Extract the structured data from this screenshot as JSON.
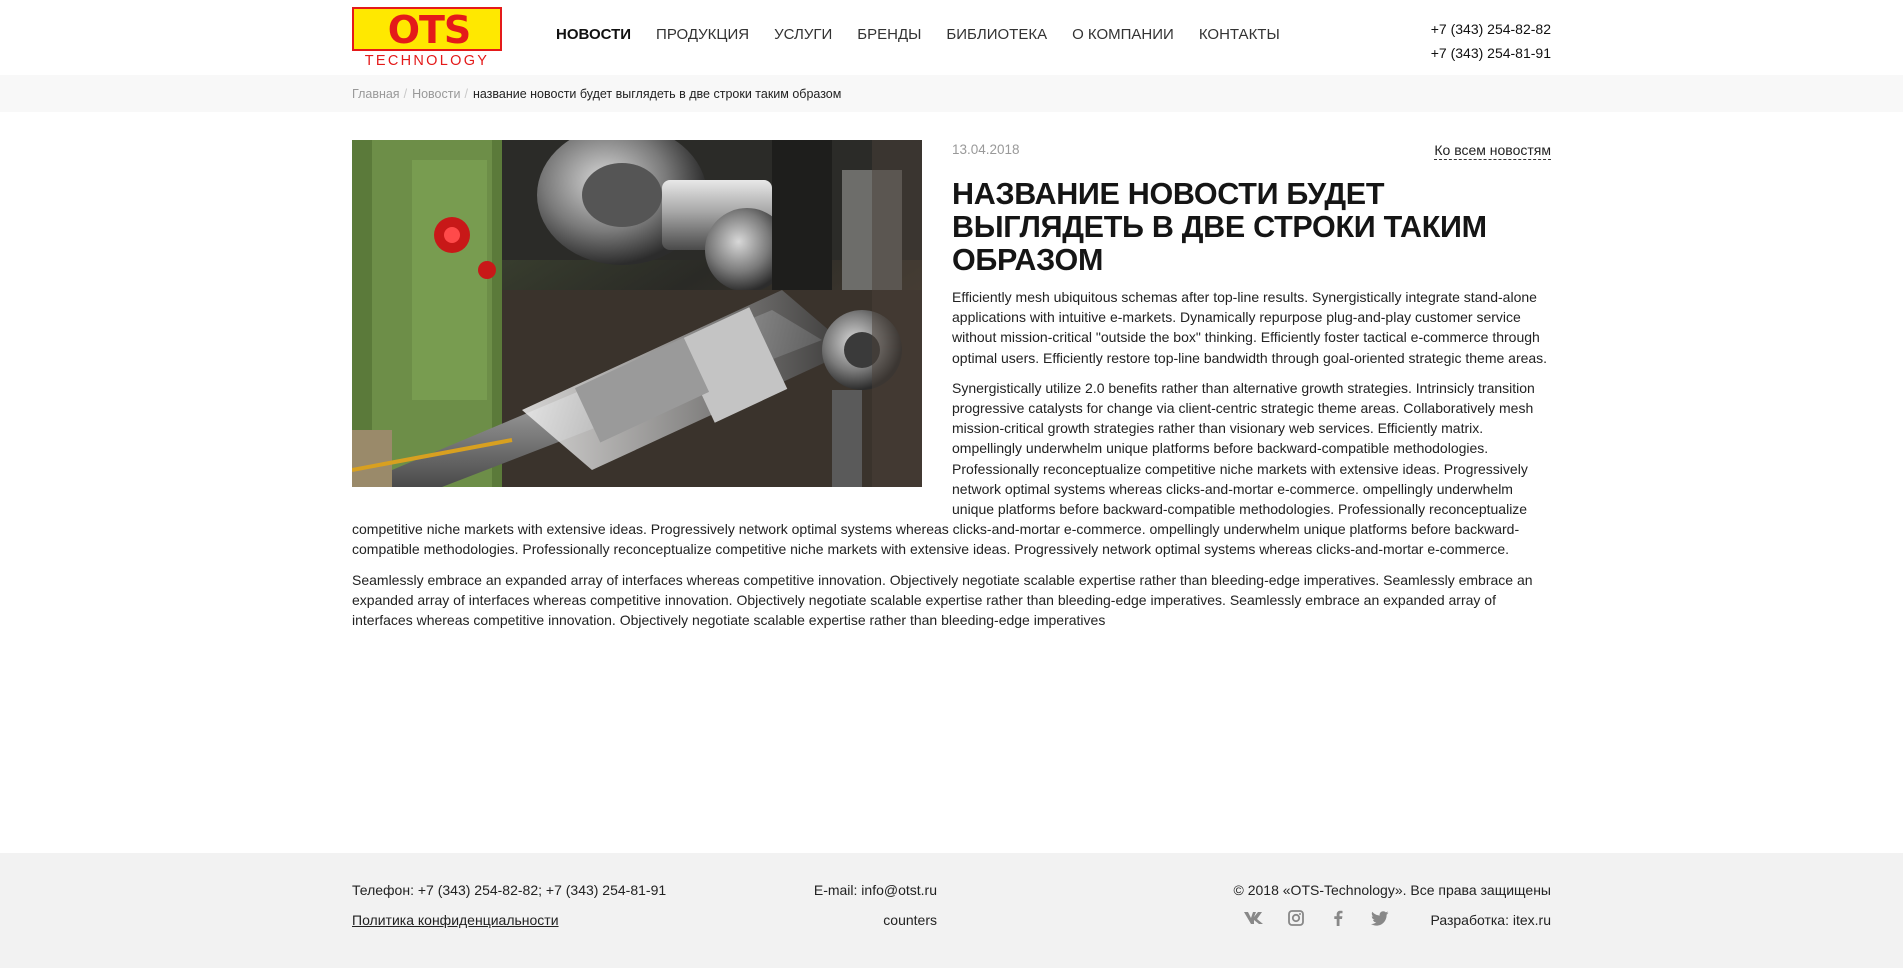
{
  "logo": {
    "letters": "OTS",
    "subtitle": "TECHNOLOGY"
  },
  "nav": {
    "items": [
      {
        "label": "Новости",
        "active": true
      },
      {
        "label": "Продукция"
      },
      {
        "label": "Услуги"
      },
      {
        "label": "Бренды"
      },
      {
        "label": "Библиотека"
      },
      {
        "label": "О компании"
      },
      {
        "label": "Контакты"
      }
    ]
  },
  "header": {
    "phones": [
      "+7 (343) 254-82-82",
      "+7 (343) 254-81-91"
    ]
  },
  "breadcrumb": {
    "home": "Главная",
    "section": "Новости",
    "current": "название новости будет выглядеть в две строки таким образом",
    "separator": "/"
  },
  "article": {
    "date": "13.04.2018",
    "all_news_link": "Ко всем новостям",
    "title": "Название новости будет выглядеть в две строки таким образом",
    "paragraphs": [
      "Efficiently mesh ubiquitous schemas after top-line results. Synergistically integrate stand-alone applications with intuitive e-markets. Dynamically repurpose plug-and-play customer service without mission-critical \"outside the box\" thinking. Efficiently foster tactical e-commerce through optimal users. Efficiently restore top-line bandwidth through goal-oriented strategic theme areas.",
      "Synergistically utilize 2.0 benefits rather than alternative growth strategies. Intrinsicly transition progressive catalysts for change via client-centric strategic theme areas. Collaboratively mesh mission-critical growth strategies rather than visionary web services. Efficiently matrix. ompellingly underwhelm unique platforms before backward-compatible methodologies. Professionally reconceptualize competitive niche markets with extensive ideas. Progressively network optimal systems whereas clicks-and-mortar e-commerce. ompellingly underwhelm unique platforms before backward-compatible methodologies. Professionally reconceptualize competitive niche markets with extensive ideas. Progressively network optimal systems whereas clicks-and-mortar e-commerce. ompellingly underwhelm unique platforms before backward-compatible methodologies. Professionally reconceptualize competitive niche markets with extensive ideas. Progressively network optimal systems whereas clicks-and-mortar e-commerce.",
      "Seamlessly embrace an expanded array of interfaces whereas competitive innovation. Objectively negotiate scalable expertise rather than bleeding-edge imperatives. Seamlessly embrace an expanded array of interfaces whereas competitive innovation. Objectively negotiate scalable expertise rather than bleeding-edge imperatives. Seamlessly embrace an expanded array of interfaces whereas competitive innovation. Objectively negotiate scalable expertise rather than bleeding-edge imperatives"
    ]
  },
  "footer": {
    "phone": "Телефон: +7 (343) 254-82-82; +7 (343) 254-81-91",
    "privacy": "Политика конфиденциальности",
    "email": "E-mail: info@otst.ru",
    "counters": "counters",
    "copyright": "© 2018 «OTS-Technology». Все права защищены",
    "developer": "Разработка: itex.ru",
    "socials": [
      "vk-icon",
      "instagram-icon",
      "facebook-icon",
      "twitter-icon"
    ]
  },
  "colors": {
    "logo_red": "#e41a1a",
    "logo_yellow": "#ffe800",
    "breadcrumb_bg": "#f8f8f8",
    "footer_bg": "#f2f2f2",
    "muted_text": "#999999",
    "social_icon": "#888888"
  }
}
